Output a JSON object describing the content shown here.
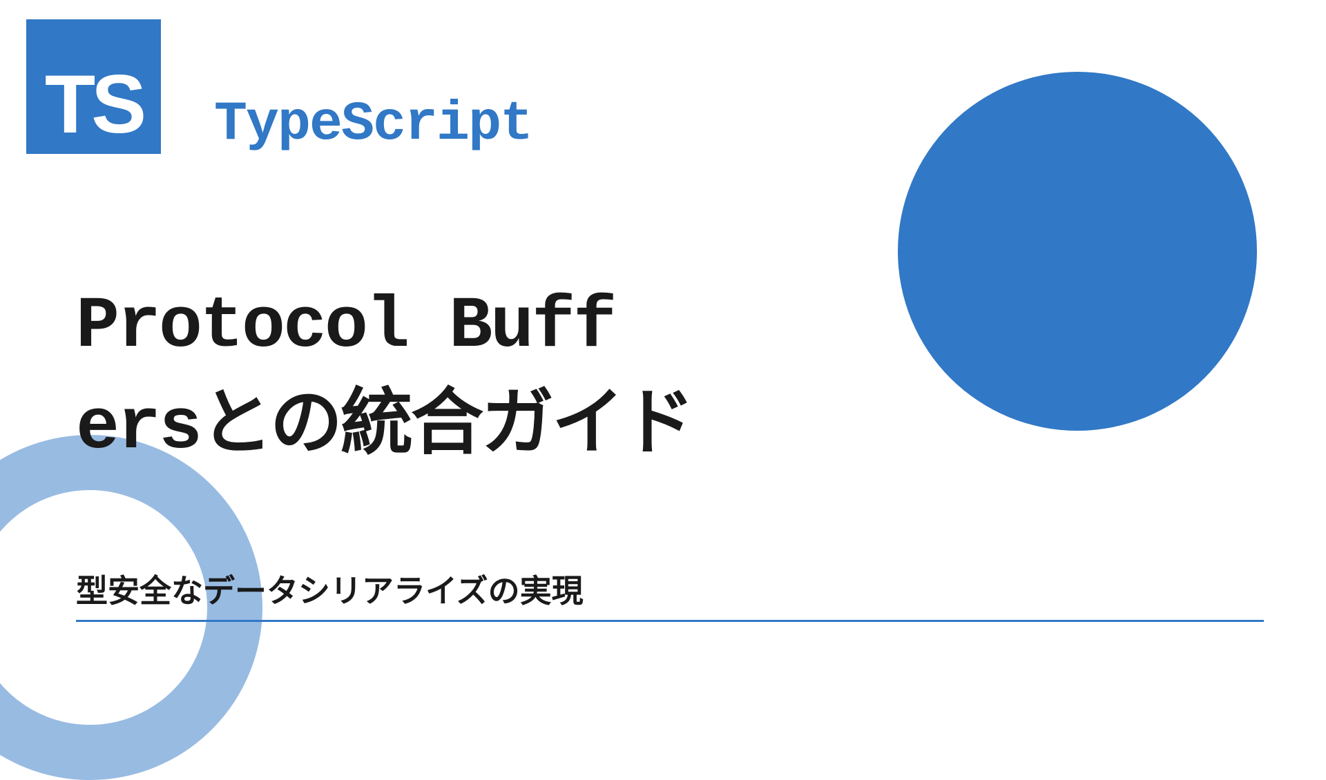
{
  "logo": {
    "text": "TS"
  },
  "brand": "TypeScript",
  "title": "Protocol Buff\nersとの統合ガイド",
  "subtitle": "型安全なデータシリアライズの実現",
  "colors": {
    "primary": "#3178c6",
    "text": "#1a1a1a",
    "background": "#ffffff"
  }
}
